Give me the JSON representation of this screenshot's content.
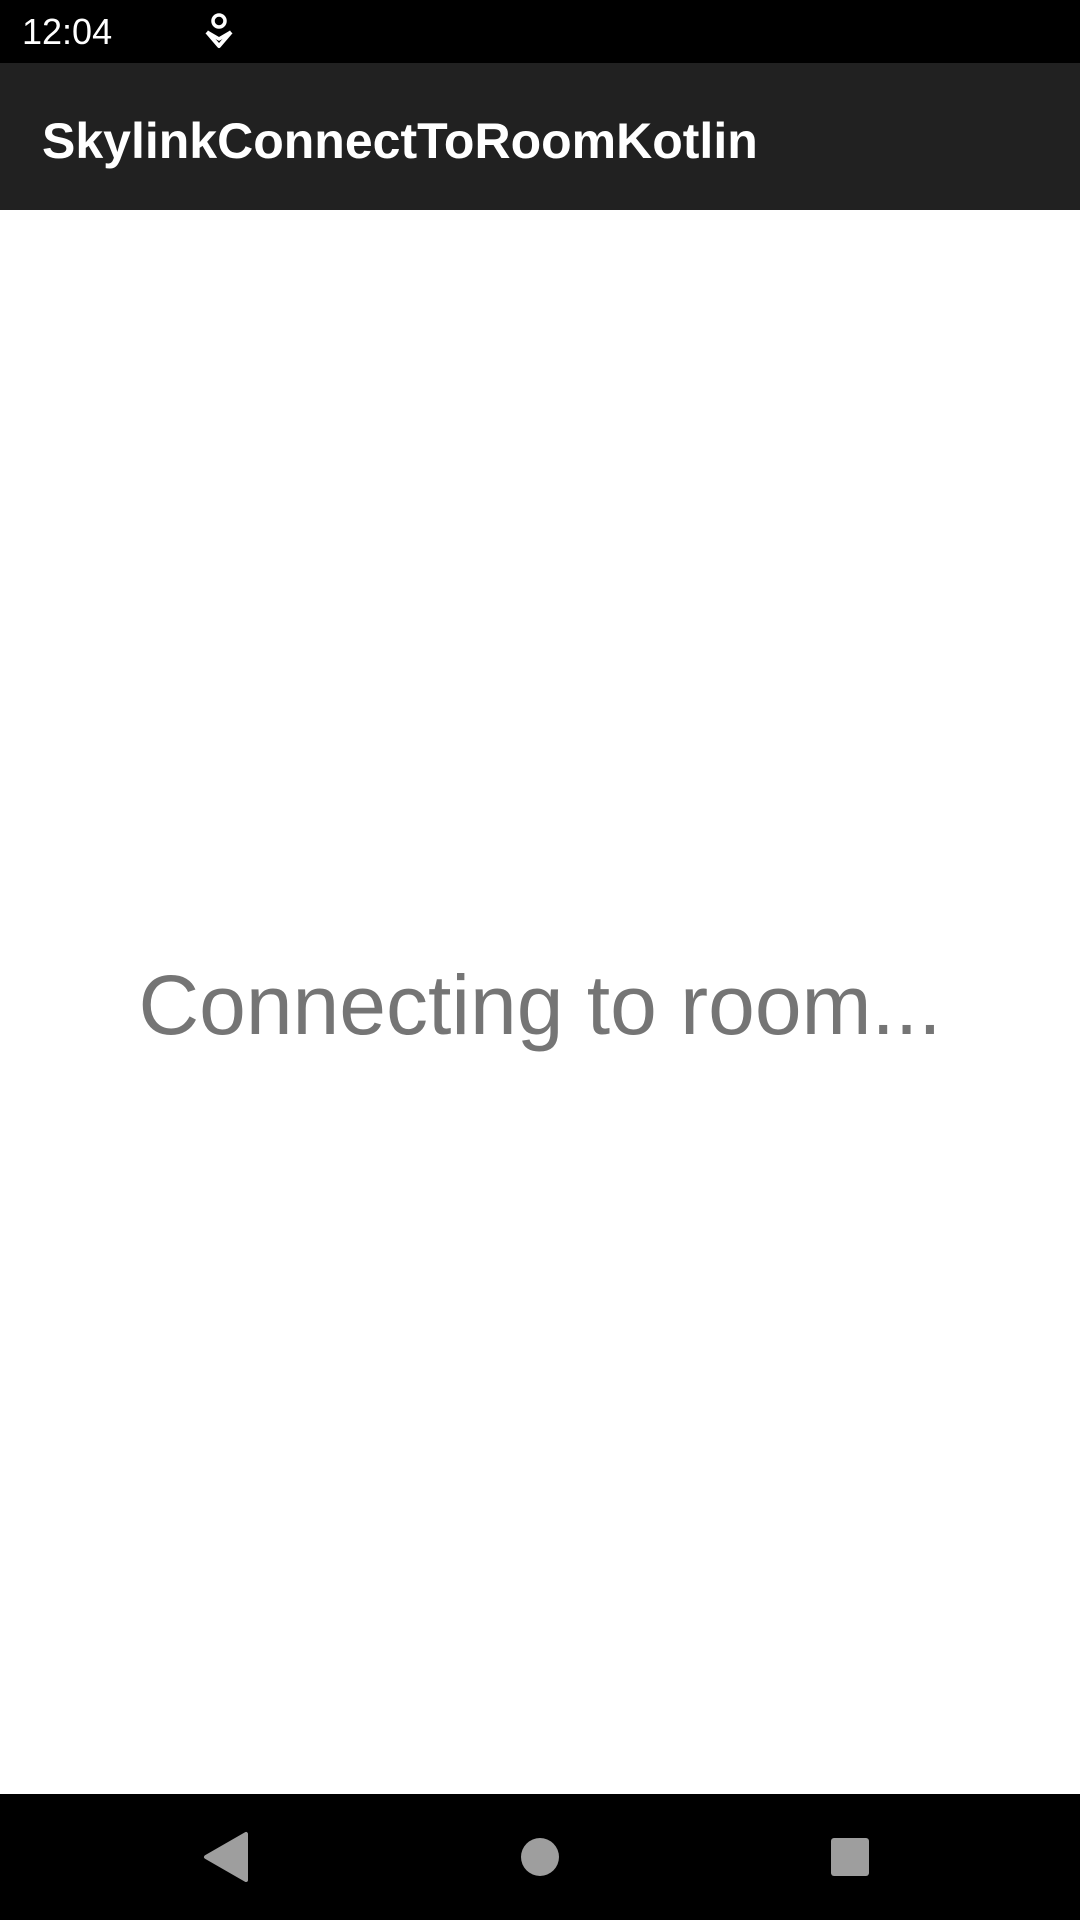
{
  "status_bar": {
    "time": "12:04",
    "notification_icon": "download-notification-icon"
  },
  "app_bar": {
    "title": "SkylinkConnectToRoomKotlin"
  },
  "main": {
    "message": "Connecting to room..."
  },
  "nav_bar": {
    "back_icon": "back-triangle-icon",
    "home_icon": "home-circle-icon",
    "recents_icon": "recents-square-icon"
  },
  "colors": {
    "status_bar_bg": "#000000",
    "app_bar_bg": "#212121",
    "content_bg": "#ffffff",
    "message_text": "#757575",
    "nav_bar_bg": "#000000",
    "nav_icon": "#9e9e9e"
  }
}
